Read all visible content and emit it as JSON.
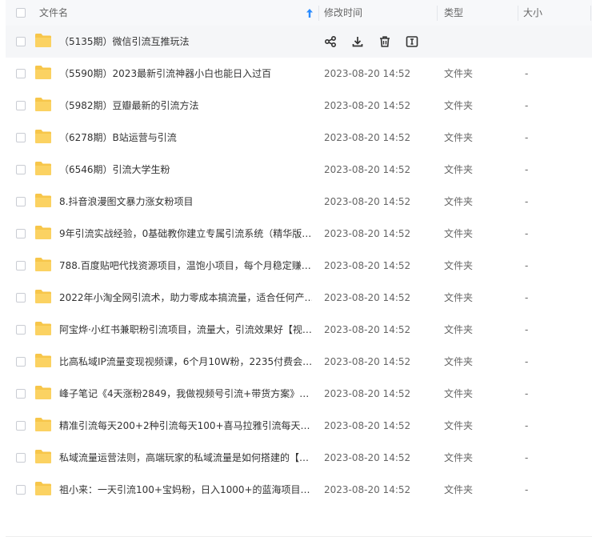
{
  "header": {
    "name_label": "文件名",
    "modified_label": "修改时间",
    "type_label": "类型",
    "size_label": "大小"
  },
  "colors": {
    "accent": "#2b8cff",
    "folder": "#f7c64a",
    "row_hover": "#f5f6f8"
  },
  "actions": [
    "share-icon",
    "download-icon",
    "delete-icon",
    "rename-icon"
  ],
  "files": [
    {
      "name": "（5135期）微信引流互推玩法",
      "modified": "",
      "type": "",
      "size": ""
    },
    {
      "name": "（5590期）2023最新引流神器小白也能日入过百",
      "modified": "2023-08-20 14:52",
      "type": "文件夹",
      "size": "-"
    },
    {
      "name": "（5982期）豆瓣最新的引流方法",
      "modified": "2023-08-20 14:52",
      "type": "文件夹",
      "size": "-"
    },
    {
      "name": "（6278期）B站运营与引流",
      "modified": "2023-08-20 14:52",
      "type": "文件夹",
      "size": "-"
    },
    {
      "name": "（6546期）引流大学生粉",
      "modified": "2023-08-20 14:52",
      "type": "文件夹",
      "size": "-"
    },
    {
      "name": "8.抖音浪漫图文暴力涨女粉项目",
      "modified": "2023-08-20 14:52",
      "type": "文件夹",
      "size": "-"
    },
    {
      "name": "9年引流实战经验，0基础教你建立专属引流系统（精华版…",
      "modified": "2023-08-20 14:52",
      "type": "文件夹",
      "size": "-"
    },
    {
      "name": "788.百度贴吧代找资源项目，温饱小项目，每个月稳定赚…",
      "modified": "2023-08-20 14:52",
      "type": "文件夹",
      "size": "-"
    },
    {
      "name": "2022年小淘全网引流术，助力零成本搞流量，适合任何产…",
      "modified": "2023-08-20 14:52",
      "type": "文件夹",
      "size": "-"
    },
    {
      "name": "阿宝烨·小红书兼职粉引流项目，流量大，引流效果好【视…",
      "modified": "2023-08-20 14:52",
      "type": "文件夹",
      "size": "-"
    },
    {
      "name": "比高私域IP流量变现视频课，6个月10W粉，2235付费会…",
      "modified": "2023-08-20 14:52",
      "type": "文件夹",
      "size": "-"
    },
    {
      "name": "峰子笔记《4天涨粉2849，我做视频号引流+带货方案》…",
      "modified": "2023-08-20 14:52",
      "type": "文件夹",
      "size": "-"
    },
    {
      "name": "精准引流每天200+2种引流每天100+喜马拉雅引流每天…",
      "modified": "2023-08-20 14:52",
      "type": "文件夹",
      "size": "-"
    },
    {
      "name": "私域流量运营法则，高端玩家的私域流量是如何搭建的【…",
      "modified": "2023-08-20 14:52",
      "type": "文件夹",
      "size": "-"
    },
    {
      "name": "祖小来：一天引流100+宝妈粉，日入1000+的蓝海项目…",
      "modified": "2023-08-20 14:52",
      "type": "文件夹",
      "size": "-"
    }
  ]
}
